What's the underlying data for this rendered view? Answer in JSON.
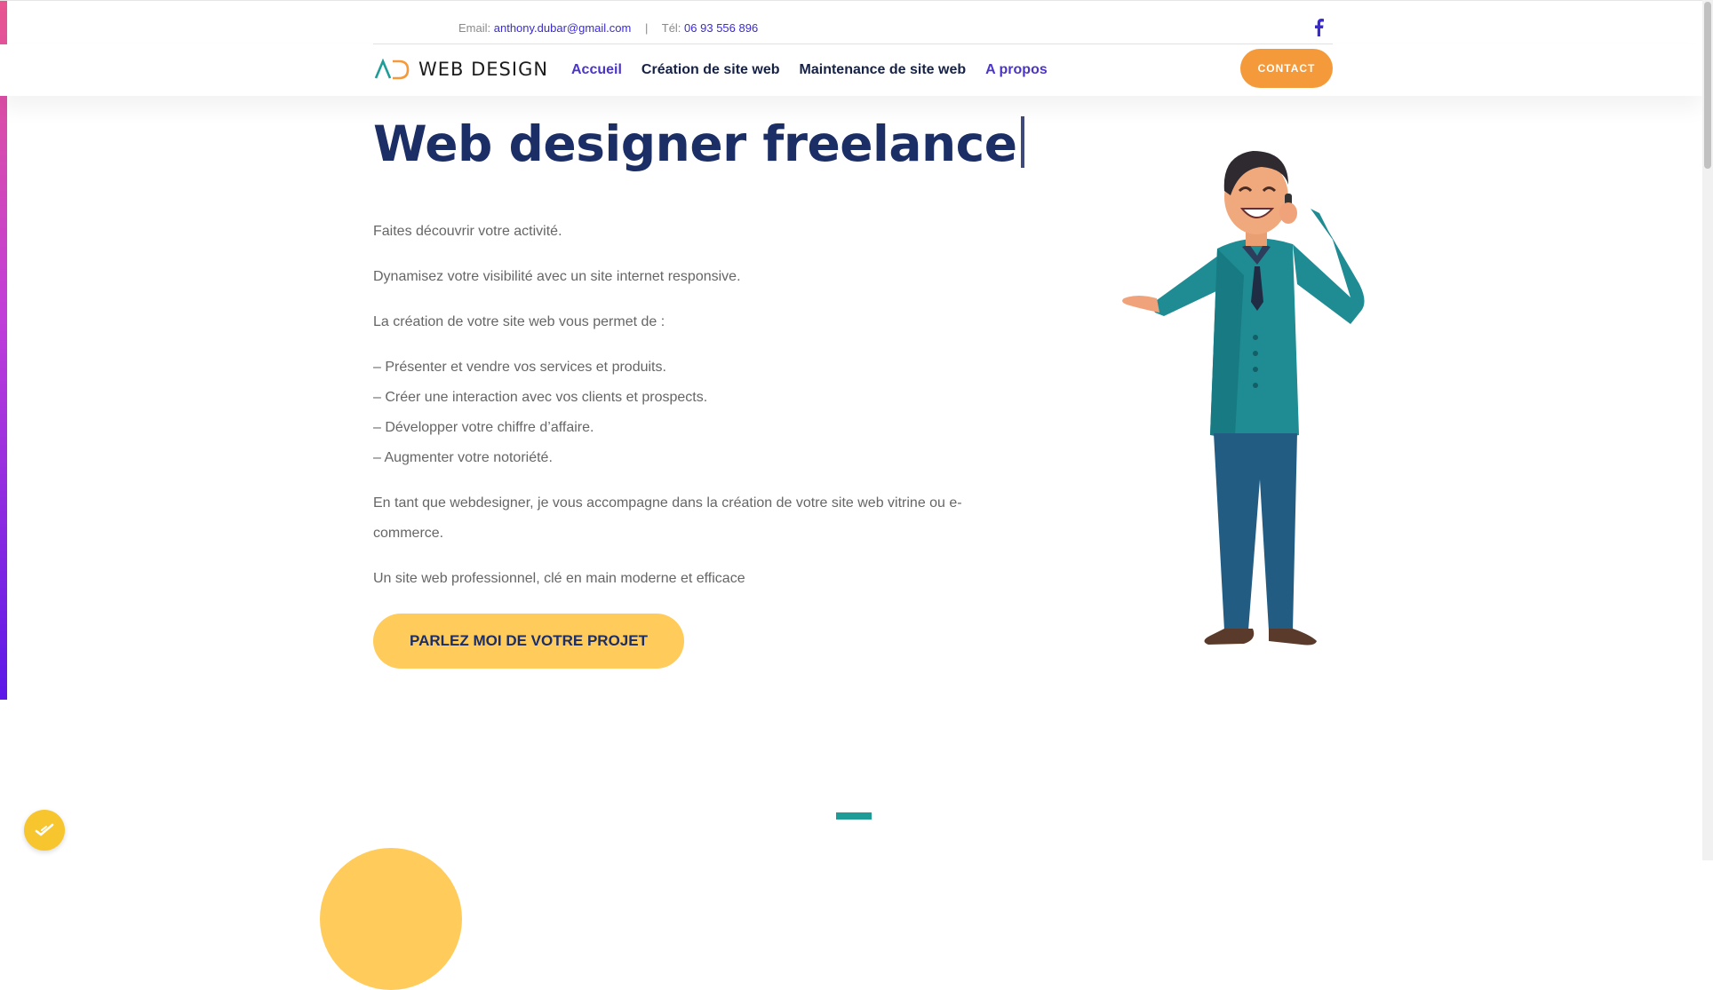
{
  "topbar": {
    "email_label": "Email:",
    "email": "anthony.dubar@gmail.com",
    "separator": "|",
    "phone_label": "Tél:",
    "phone": "06 93 556 896",
    "social_icon": "facebook-icon"
  },
  "header": {
    "logo_mark": "AD",
    "logo_text": "WEB DESIGN",
    "nav": [
      {
        "label": "Accueil"
      },
      {
        "label": "Création de site web"
      },
      {
        "label": "Maintenance de site web"
      },
      {
        "label": "A propos"
      }
    ],
    "contact_button": "CONTACT"
  },
  "hero": {
    "title": "Web designer freelance",
    "paragraphs": [
      "Faites découvrir votre activité.",
      "Dynamisez votre visibilité avec un site internet responsive.",
      "La création de votre site web vous permet de :"
    ],
    "list": [
      "–  Présenter et vendre vos services et produits.",
      "–  Créer une interaction avec vos clients et prospects.",
      "–  Développer votre chiffre d’affaire.",
      "–  Augmenter votre notoriété."
    ],
    "after_list": [
      "En tant que webdesigner, je vous accompagne dans la création de votre site web vitrine ou e-commerce.",
      "Un site web professionnel, clé en main moderne et efficace"
    ],
    "cta": "PARLEZ MOI DE VOTRE PROJET"
  },
  "colors": {
    "primary": "#1c2e66",
    "accent_purple": "#4a35c8",
    "accent_orange": "#f59a3b",
    "accent_yellow": "#ffcb5b",
    "teal": "#1f9c97"
  },
  "badge_icon": "checkmark-icon"
}
